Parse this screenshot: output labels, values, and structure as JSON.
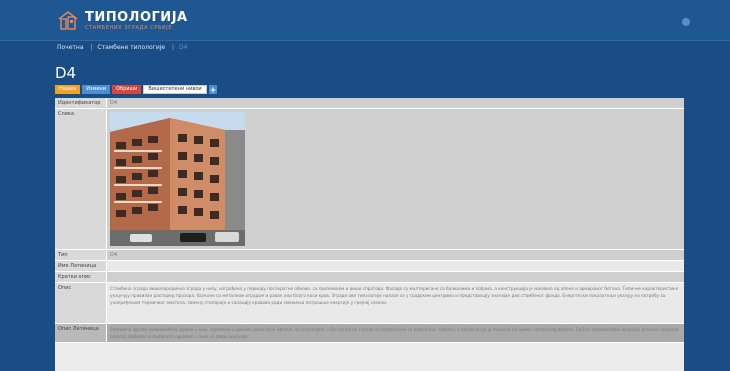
{
  "app": {
    "logo_title": "ТИПОЛОГИЈА",
    "logo_subtitle": "СТАМБЕНИХ ЗГРАДА СРБИЈЕ"
  },
  "breadcrumb": {
    "items": [
      "Почетна",
      "Стамбене типологије",
      "D4"
    ]
  },
  "page": {
    "title": "D4"
  },
  "actions": {
    "buttons": [
      "Најава",
      "Измени",
      "Обриши",
      "Вишестепени нивои"
    ],
    "icon": "add-icon"
  },
  "table": {
    "rows": [
      {
        "label": "Идентификатор",
        "value": "D4"
      },
      {
        "label": "Слика",
        "value": ""
      },
      {
        "label": "Тип",
        "value": "D4"
      },
      {
        "label": "Име Латиница",
        "value": ""
      },
      {
        "label": "Кратки опис",
        "value": ""
      },
      {
        "label": "Опис",
        "value": "Стамбена зграда вишепородична зграда у низу, изграђена у периоду послератне обнове, са приземљем и више спратова. Фасаде су малтерисане са балконима и лођама, а конструкција је масивна од опеке и армираног бетона. Типичне карактеристике укључују правилан распоред прозора, балконе са металном оградом и раван или благо коси кров. Зграде ове типологије налазе се у градским центрима и представљају значајан део стамбеног фонда. Енергетски показатељи указују на потребу за унапређењем термичког омотача, замену столарије и санацију кровова ради смањења потрошње енергије у грејној сезони."
      },
      {
        "label": "Опис Латиница",
        "value": "Stambena zgrada višeporodična zgrada u nizu, izgrađena u periodu posleratne obnove, sa prizemljem i više spratova. Fasade su malterisane sa balkonima i lođama, a konstrukcija je masivna od opeke i armiranog betona. Tipične karakteristike uključuju pravilan raspored prozora, balkone sa metalnom ogradom i ravan ili blago kosi krov."
      }
    ]
  },
  "colors": {
    "background": "#1a4d86",
    "header": "#1f5793",
    "accent_orange": "#f0a128",
    "accent_red": "#d5473b",
    "accent_blue": "#4b8ed1"
  }
}
